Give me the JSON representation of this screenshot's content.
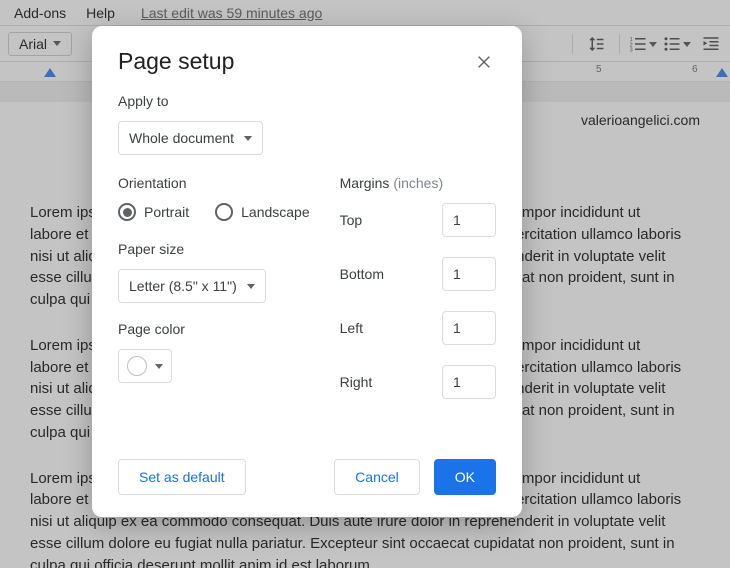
{
  "menubar": {
    "addons": "Add-ons",
    "help": "Help",
    "last_edit": "Last edit was 59 minutes ago"
  },
  "toolbar": {
    "font_name": "Arial"
  },
  "ruler": {
    "t5": "5",
    "t6": "6"
  },
  "doc": {
    "watermark": "valerioangelici.com",
    "p1": "Lorem ipsum dolor sit amet, consectetur adipiscing elit, sed do eiusmod tempor incididunt ut labore et dolore magna aliqua. Ut enim ad minim veniam, quis nostrud exercitation ullamco laboris nisi ut aliquip ex ea commodo consequat. Duis aute irure dolor in reprehenderit in voluptate velit esse cillum dolore eu fugiat nulla pariatur. Excepteur sint occaecat cupidatat non proident, sunt in culpa qui officia deserunt mollit anim id est laborum.",
    "p2": "Lorem ipsum dolor sit amet, consectetur adipiscing elit, sed do eiusmod tempor incididunt ut labore et dolore magna aliqua. Ut enim ad minim veniam, quis nostrud exercitation ullamco laboris nisi ut aliquip ex ea commodo consequat. Duis aute irure dolor in reprehenderit in voluptate velit esse cillum dolore eu fugiat nulla pariatur. Excepteur sint occaecat cupidatat non proident, sunt in culpa qui officia deserunt mollit anim id est laborum.",
    "p3": "Lorem ipsum dolor sit amet, consectetur adipiscing elit, sed do eiusmod tempor incididunt ut labore et dolore magna aliqua. Ut enim ad minim veniam, quis nostrud exercitation ullamco laboris nisi ut aliquip ex ea commodo consequat. Duis aute irure dolor in reprehenderit in voluptate velit esse cillum dolore eu fugiat nulla pariatur. Excepteur sint occaecat cupidatat non proident, sunt in culpa qui officia deserunt mollit anim id est laborum."
  },
  "dialog": {
    "title": "Page setup",
    "apply_to_label": "Apply to",
    "apply_to_value": "Whole document",
    "orientation_label": "Orientation",
    "portrait": "Portrait",
    "landscape": "Landscape",
    "paper_size_label": "Paper size",
    "paper_size_value": "Letter (8.5\" x 11\")",
    "page_color_label": "Page color",
    "margins_label": "Margins",
    "margins_unit": "(inches)",
    "top": "Top",
    "bottom": "Bottom",
    "left": "Left",
    "right": "Right",
    "top_value": "1",
    "bottom_value": "1",
    "left_value": "1",
    "right_value": "1",
    "set_default": "Set as default",
    "cancel": "Cancel",
    "ok": "OK"
  }
}
